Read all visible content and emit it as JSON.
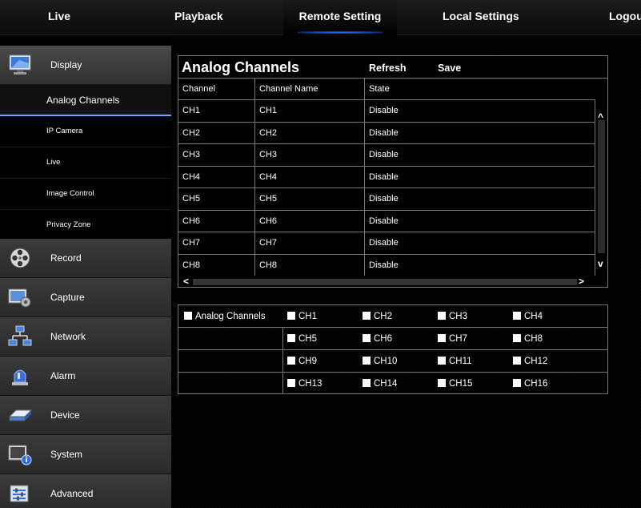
{
  "nav": {
    "tabs": [
      {
        "label": "Live"
      },
      {
        "label": "Playback"
      },
      {
        "label": "Remote Setting"
      },
      {
        "label": "Local Settings"
      },
      {
        "label": "Logou"
      }
    ],
    "active_tab": "Remote Setting"
  },
  "sidebar": {
    "categories": [
      {
        "label": "Display",
        "icon": "monitor-icon",
        "open": true
      },
      {
        "label": "Record",
        "icon": "film-reel-icon"
      },
      {
        "label": "Capture",
        "icon": "capture-gear-icon"
      },
      {
        "label": "Network",
        "icon": "network-icon"
      },
      {
        "label": "Alarm",
        "icon": "alarm-siren-icon"
      },
      {
        "label": "Device",
        "icon": "hard-drive-icon"
      },
      {
        "label": "System",
        "icon": "system-info-icon"
      },
      {
        "label": "Advanced",
        "icon": "advanced-sliders-icon"
      }
    ],
    "display_items": [
      {
        "label": "Analog Channels",
        "active": true
      },
      {
        "label": "IP Camera"
      },
      {
        "label": "Live"
      },
      {
        "label": "Image Control"
      },
      {
        "label": "Privacy Zone"
      }
    ]
  },
  "panel": {
    "title": "Analog Channels",
    "refresh_label": "Refresh",
    "save_label": "Save",
    "columns": [
      "Channel",
      "Channel Name",
      "State"
    ],
    "rows": [
      {
        "channel": "CH1",
        "name": "CH1",
        "state": "Disable"
      },
      {
        "channel": "CH2",
        "name": "CH2",
        "state": "Disable"
      },
      {
        "channel": "CH3",
        "name": "CH3",
        "state": "Disable"
      },
      {
        "channel": "CH4",
        "name": "CH4",
        "state": "Disable"
      },
      {
        "channel": "CH5",
        "name": "CH5",
        "state": "Disable"
      },
      {
        "channel": "CH6",
        "name": "CH6",
        "state": "Disable"
      },
      {
        "channel": "CH7",
        "name": "CH7",
        "state": "Disable"
      },
      {
        "channel": "CH8",
        "name": "CH8",
        "state": "Disable"
      }
    ],
    "scroll_arrows": {
      "up": "^",
      "down": "v",
      "left": "<",
      "right": ">"
    }
  },
  "selector": {
    "all_label": "Analog Channels",
    "channels": [
      "CH1",
      "CH2",
      "CH3",
      "CH4",
      "CH5",
      "CH6",
      "CH7",
      "CH8",
      "CH9",
      "CH10",
      "CH11",
      "CH12",
      "CH13",
      "CH14",
      "CH15",
      "CH16"
    ]
  },
  "colors": {
    "accent": "#2a7dff",
    "border": "#777777",
    "background": "#000000",
    "sidebar_category": "#333333"
  }
}
